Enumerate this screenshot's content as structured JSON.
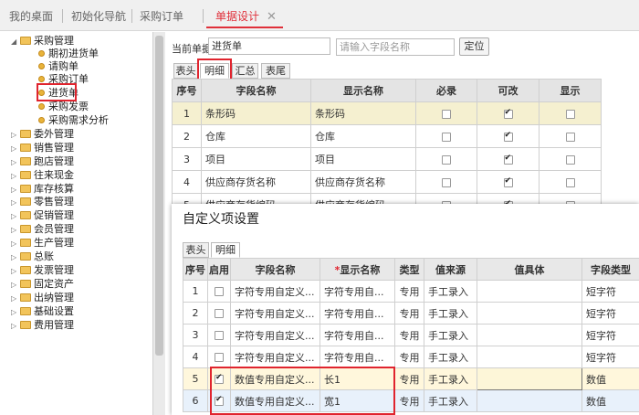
{
  "tabs": [
    {
      "label": "我的桌面"
    },
    {
      "label": "初始化导航"
    },
    {
      "label": "采购订单"
    },
    {
      "label": "单据设计"
    }
  ],
  "close_glyph": "✕",
  "sidebar": {
    "root": "采购管理",
    "children": [
      "期初进货单",
      "请购单",
      "采购订单",
      "进货单",
      "采购发票",
      "采购需求分析"
    ],
    "groups": [
      "委外管理",
      "销售管理",
      "跑店管理",
      "往来现金",
      "库存核算",
      "零售管理",
      "促销管理",
      "会员管理",
      "生产管理",
      "总账",
      "发票管理",
      "固定资产",
      "出纳管理",
      "基础设置",
      "费用管理"
    ]
  },
  "form": {
    "current_label": "当前单据",
    "current_value": "进货单",
    "search_placeholder": "请输入字段名称",
    "locate_button": "定位"
  },
  "subtabs": [
    "表头",
    "明细",
    "汇总",
    "表尾"
  ],
  "main_table": {
    "headers": [
      "序号",
      "字段名称",
      "显示名称",
      "必录",
      "可改",
      "显示"
    ],
    "rows": [
      {
        "no": "1",
        "field": "条形码",
        "display": "条形码",
        "req": false,
        "edit": true,
        "show": false
      },
      {
        "no": "2",
        "field": "仓库",
        "display": "仓库",
        "req": false,
        "edit": true,
        "show": false
      },
      {
        "no": "3",
        "field": "项目",
        "display": "项目",
        "req": false,
        "edit": true,
        "show": false
      },
      {
        "no": "4",
        "field": "供应商存货名称",
        "display": "供应商存货名称",
        "req": false,
        "edit": true,
        "show": false
      },
      {
        "no": "5",
        "field": "供应商存货编码",
        "display": "供应商存货编码",
        "req": false,
        "edit": true,
        "show": false
      }
    ]
  },
  "dialog": {
    "title": "自定义项设置",
    "tabs": [
      "表头",
      "明细"
    ],
    "headers": [
      "序号",
      "启用",
      "字段名称",
      "显示名称",
      "类型",
      "值来源",
      "值具体",
      "字段类型"
    ],
    "required_mark": "*",
    "rows": [
      {
        "no": "1",
        "on": false,
        "field": "字符专用自定义...",
        "display": "字符专用自...",
        "type": "专用",
        "source": "手工录入",
        "detail": "",
        "ftype": "短字符"
      },
      {
        "no": "2",
        "on": false,
        "field": "字符专用自定义...",
        "display": "字符专用自...",
        "type": "专用",
        "source": "手工录入",
        "detail": "",
        "ftype": "短字符"
      },
      {
        "no": "3",
        "on": false,
        "field": "字符专用自定义...",
        "display": "字符专用自...",
        "type": "专用",
        "source": "手工录入",
        "detail": "",
        "ftype": "短字符"
      },
      {
        "no": "4",
        "on": false,
        "field": "字符专用自定义...",
        "display": "字符专用自...",
        "type": "专用",
        "source": "手工录入",
        "detail": "",
        "ftype": "短字符"
      },
      {
        "no": "5",
        "on": true,
        "field": "数值专用自定义...",
        "display": "长1",
        "type": "专用",
        "source": "手工录入",
        "detail": "",
        "ftype": "数值"
      },
      {
        "no": "6",
        "on": true,
        "field": "数值专用自定义...",
        "display": "宽1",
        "type": "专用",
        "source": "手工录入",
        "detail": "",
        "ftype": "数值"
      }
    ]
  },
  "colors": {
    "accent": "#e0303a",
    "highlight": "#e0242e",
    "selected_row": "#f5f0d0"
  }
}
